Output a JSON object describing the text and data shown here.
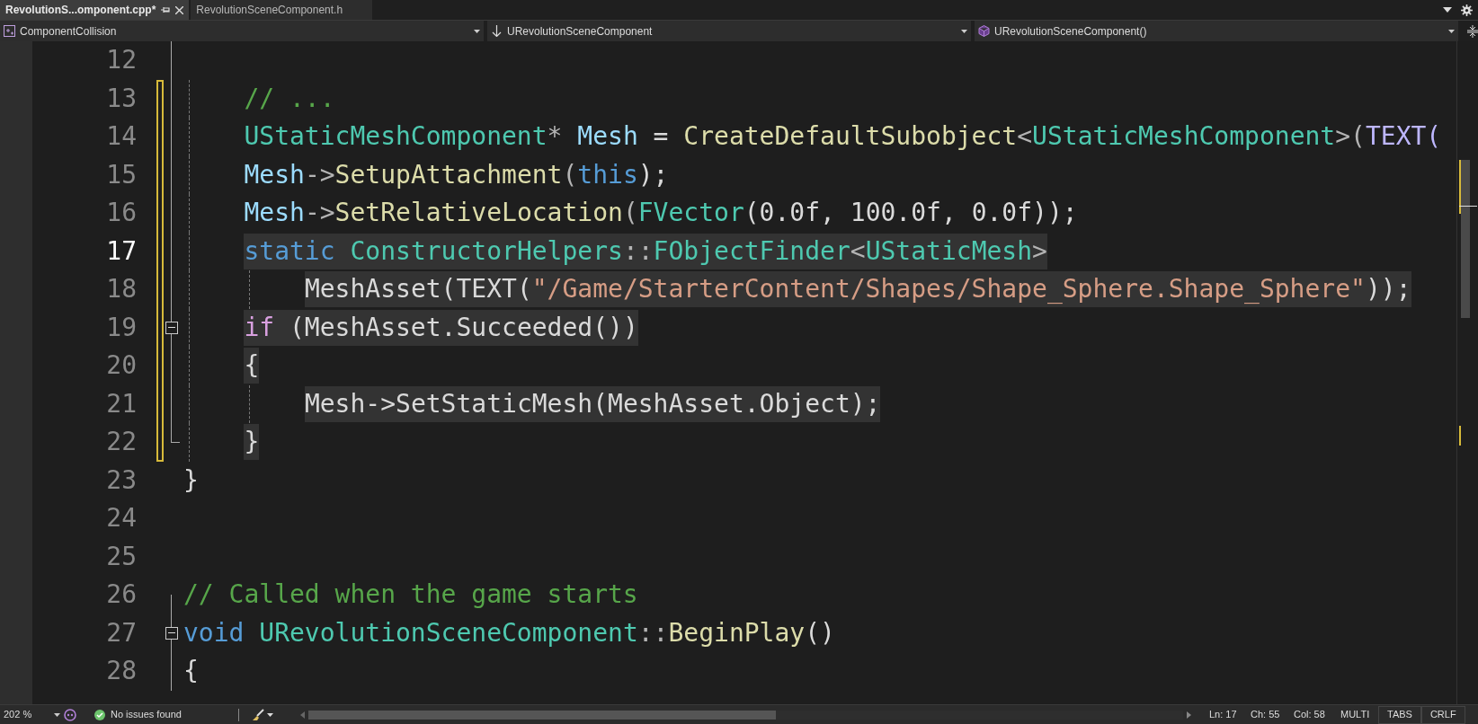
{
  "tabs": [
    {
      "label": "RevolutionS...omponent.cpp*",
      "selected": true,
      "pinned": true
    },
    {
      "label": "RevolutionSceneComponent.h",
      "selected": false,
      "pinned": false
    }
  ],
  "nav": [
    {
      "kind": "project",
      "label": "ComponentCollision"
    },
    {
      "kind": "class",
      "label": "URevolutionSceneComponent"
    },
    {
      "kind": "method",
      "label": "URevolutionSceneComponent()"
    }
  ],
  "lines": [
    {
      "number": "12",
      "current": false,
      "changed": false,
      "highlighted": false,
      "collapsible": false
    },
    {
      "number": "13",
      "current": false,
      "changed": true,
      "highlighted": false,
      "collapsible": false,
      "tokens": [
        {
          "text": "    // ...",
          "kind": "comment"
        }
      ]
    },
    {
      "number": "14",
      "current": false,
      "changed": true,
      "highlighted": false,
      "collapsible": false,
      "tokens": [
        {
          "text": "    UStaticMeshComponent",
          "kind": "type"
        },
        {
          "text": "* ",
          "kind": "punct"
        },
        {
          "text": "Mesh",
          "kind": "var"
        },
        {
          "text": " = ",
          "kind": "plain"
        },
        {
          "text": "CreateDefaultSubobject",
          "kind": "func"
        },
        {
          "text": "<",
          "kind": "punct"
        },
        {
          "text": "UStaticMeshComponent",
          "kind": "type"
        },
        {
          "text": ">(",
          "kind": "punct"
        },
        {
          "text": "TEXT(",
          "kind": "macro"
        }
      ]
    },
    {
      "number": "15",
      "current": false,
      "changed": true,
      "highlighted": false,
      "collapsible": false,
      "tokens": [
        {
          "text": "    Mesh",
          "kind": "var"
        },
        {
          "text": "->",
          "kind": "punct"
        },
        {
          "text": "SetupAttachment",
          "kind": "func"
        },
        {
          "text": "(",
          "kind": "punct"
        },
        {
          "text": "this",
          "kind": "keyword"
        },
        {
          "text": ");",
          "kind": "plain"
        }
      ]
    },
    {
      "number": "16",
      "current": false,
      "changed": true,
      "highlighted": false,
      "collapsible": false,
      "tokens": [
        {
          "text": "    Mesh",
          "kind": "var"
        },
        {
          "text": "->",
          "kind": "punct"
        },
        {
          "text": "SetRelativeLocation",
          "kind": "func"
        },
        {
          "text": "(",
          "kind": "punct"
        },
        {
          "text": "FVector",
          "kind": "type"
        },
        {
          "text": "(0.0f, 100.0f, 0.0f));",
          "kind": "plain"
        }
      ]
    },
    {
      "number": "17",
      "current": true,
      "changed": true,
      "highlighted": true,
      "collapsible": false,
      "tokens": [
        {
          "text": "    static ",
          "kind": "keyword"
        },
        {
          "text": "ConstructorHelpers",
          "kind": "type"
        },
        {
          "text": "::",
          "kind": "punct"
        },
        {
          "text": "FObjectFinder",
          "kind": "type"
        },
        {
          "text": "<",
          "kind": "punct"
        },
        {
          "text": "UStaticMesh",
          "kind": "type"
        },
        {
          "text": ">",
          "kind": "punct"
        }
      ]
    },
    {
      "number": "18",
      "current": false,
      "changed": true,
      "highlighted": true,
      "collapsible": false,
      "tokens": [
        {
          "text": "        MeshAsset(TEXT(",
          "kind": "plain"
        },
        {
          "text": "\"/Game/StarterContent/Shapes/Shape_Sphere.Shape_Sphere\"",
          "kind": "string"
        },
        {
          "text": "));",
          "kind": "plain"
        }
      ]
    },
    {
      "number": "19",
      "current": false,
      "changed": true,
      "highlighted": true,
      "collapsible": true,
      "tokens": [
        {
          "text": "    if",
          "kind": "control"
        },
        {
          "text": " (MeshAsset.Succeeded())",
          "kind": "plain"
        }
      ]
    },
    {
      "number": "20",
      "current": false,
      "changed": true,
      "highlighted": true,
      "collapsible": false,
      "tokens": [
        {
          "text": "    {",
          "kind": "plain"
        }
      ]
    },
    {
      "number": "21",
      "current": false,
      "changed": true,
      "highlighted": true,
      "collapsible": false,
      "tokens": [
        {
          "text": "        Mesh->SetStaticMesh(MeshAsset.Object);",
          "kind": "plain"
        }
      ]
    },
    {
      "number": "22",
      "current": false,
      "changed": true,
      "highlighted": true,
      "collapsible": false,
      "tokens": [
        {
          "text": "    }",
          "kind": "plain"
        }
      ]
    },
    {
      "number": "23",
      "current": false,
      "changed": false,
      "highlighted": false,
      "collapsible": false,
      "tokens": [
        {
          "text": "}",
          "kind": "plain"
        }
      ]
    },
    {
      "number": "24",
      "current": false,
      "changed": false,
      "highlighted": false,
      "collapsible": false
    },
    {
      "number": "25",
      "current": false,
      "changed": false,
      "highlighted": false,
      "collapsible": false
    },
    {
      "number": "26",
      "current": false,
      "changed": false,
      "highlighted": false,
      "collapsible": false,
      "tokens": [
        {
          "text": "// Called when the game starts",
          "kind": "comment"
        }
      ]
    },
    {
      "number": "27",
      "current": false,
      "changed": false,
      "highlighted": false,
      "collapsible": true,
      "tokens": [
        {
          "text": "void ",
          "kind": "keyword"
        },
        {
          "text": "URevolutionSceneComponent",
          "kind": "type"
        },
        {
          "text": "::",
          "kind": "punct"
        },
        {
          "text": "BeginPlay",
          "kind": "func"
        },
        {
          "text": "()",
          "kind": "plain"
        }
      ]
    },
    {
      "number": "28",
      "current": false,
      "changed": false,
      "highlighted": false,
      "collapsible": false,
      "tokens": [
        {
          "text": "{",
          "kind": "plain"
        }
      ]
    }
  ],
  "status": {
    "zoom": "202 %",
    "issues": "No issues found",
    "ln": "Ln: 17",
    "ch": "Ch: 55",
    "col": "Col: 58",
    "mode": "MULTI",
    "indent": "TABS",
    "eol": "CRLF"
  }
}
